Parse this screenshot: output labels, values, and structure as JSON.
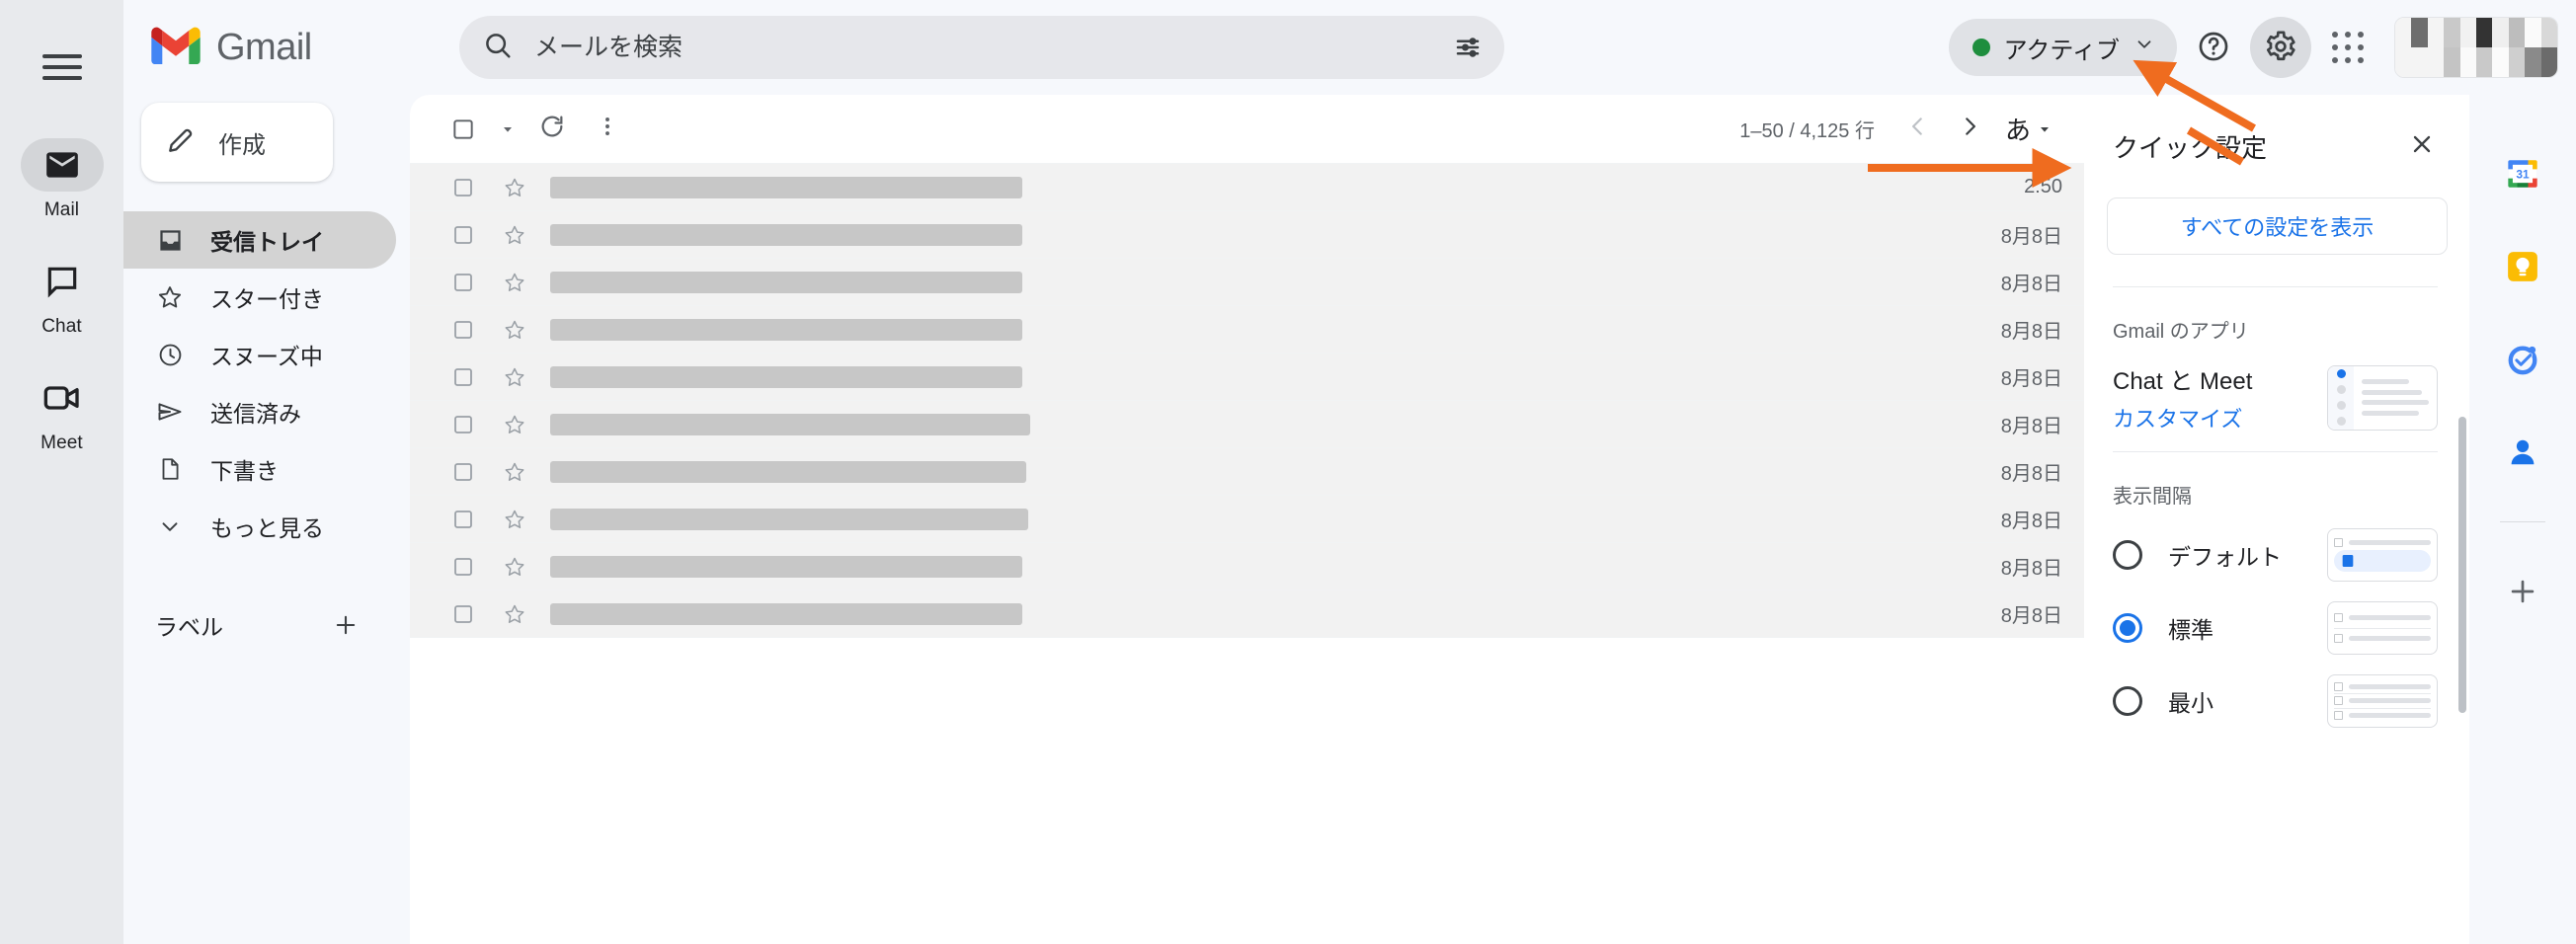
{
  "brand": {
    "name": "Gmail"
  },
  "rail": {
    "menu_icon": "hamburger-menu-icon",
    "items": [
      {
        "label": "Mail",
        "icon": "mail-icon",
        "active": true
      },
      {
        "label": "Chat",
        "icon": "chat-icon",
        "active": false
      },
      {
        "label": "Meet",
        "icon": "meet-camera-icon",
        "active": false
      }
    ]
  },
  "search": {
    "placeholder": "メールを検索",
    "value": "",
    "icon": "search-icon",
    "options_icon": "search-options-icon"
  },
  "header": {
    "status": {
      "label": "アクティブ",
      "dot_color": "#1e8e3e",
      "chevron": "chevron-down-icon"
    },
    "help_icon": "help-circle-icon",
    "settings_icon": "gear-icon",
    "apps_icon": "apps-grid-icon",
    "avatar": "avatar-image"
  },
  "sidebar": {
    "compose": {
      "label": "作成",
      "icon": "pencil-icon"
    },
    "items": [
      {
        "label": "受信トレイ",
        "icon": "inbox-icon",
        "active": true
      },
      {
        "label": "スター付き",
        "icon": "star-icon",
        "active": false
      },
      {
        "label": "スヌーズ中",
        "icon": "clock-icon",
        "active": false
      },
      {
        "label": "送信済み",
        "icon": "send-icon",
        "active": false
      },
      {
        "label": "下書き",
        "icon": "draft-file-icon",
        "active": false
      },
      {
        "label": "もっと見る",
        "icon": "chevron-down-icon",
        "active": false
      }
    ],
    "labels": {
      "title": "ラベル",
      "add_icon": "plus-icon"
    }
  },
  "list_toolbar": {
    "select_all_icon": "checkbox-icon",
    "select_all_chevron": "chevron-down-icon",
    "refresh_icon": "refresh-icon",
    "more_icon": "more-vertical-icon",
    "pagecount": "1–50 / 4,125 行",
    "prev_icon": "chevron-left-icon",
    "next_icon": "chevron-right-icon",
    "ime": {
      "label": "あ",
      "chevron": "chevron-down-icon"
    }
  },
  "mail_rows": [
    {
      "date": "2:50",
      "redacted_width": 478
    },
    {
      "date": "8月8日",
      "redacted_width": 478
    },
    {
      "date": "8月8日",
      "redacted_width": 478
    },
    {
      "date": "8月8日",
      "redacted_width": 478
    },
    {
      "date": "8月8日",
      "redacted_width": 478
    },
    {
      "date": "8月8日",
      "redacted_width": 486
    },
    {
      "date": "8月8日",
      "redacted_width": 482
    },
    {
      "date": "8月8日",
      "redacted_width": 484
    },
    {
      "date": "8月8日",
      "redacted_width": 478
    },
    {
      "date": "8月8日",
      "redacted_width": 478
    }
  ],
  "quick_settings": {
    "title": "クイック設定",
    "close_icon": "close-icon",
    "all_settings_label": "すべての設定を表示",
    "apps_section": {
      "title": "Gmail のアプリ",
      "row_title": "Chat と Meet",
      "row_link": "カスタマイズ"
    },
    "density_section": {
      "title": "表示間隔",
      "options": [
        {
          "label": "デフォルト",
          "selected": false,
          "lines": 1
        },
        {
          "label": "標準",
          "selected": true,
          "lines": 2
        },
        {
          "label": "最小",
          "selected": false,
          "lines": 3
        }
      ]
    }
  },
  "sidepanel": {
    "items": [
      {
        "name": "google-calendar-icon",
        "label": "31"
      },
      {
        "name": "google-keep-icon",
        "label": ""
      },
      {
        "name": "google-tasks-icon",
        "label": ""
      },
      {
        "name": "google-contacts-icon",
        "label": ""
      }
    ],
    "add_icon": "plus-icon"
  },
  "annotations": {
    "accent_color": "#ef6c1f",
    "arrow_to_gear": "arrow-pointing-to-settings-gear",
    "arrow_to_all_settings": "arrow-pointing-to-all-settings-button"
  }
}
